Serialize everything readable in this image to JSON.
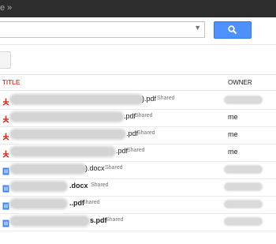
{
  "topbar": {
    "text": "e »"
  },
  "search": {
    "value": "",
    "arrow": "▼"
  },
  "columns": {
    "title": "TITLE",
    "owner": "OWNER"
  },
  "rows": [
    {
      "icon": "pdf-icon",
      "ext": ").pdf",
      "shared": "Shared",
      "owner": ""
    },
    {
      "icon": "pdf-icon",
      "ext": ".pdf",
      "shared": "Shared",
      "owner": "me"
    },
    {
      "icon": "pdf-icon",
      "ext": ".pdf",
      "shared": "Shared",
      "owner": "me"
    },
    {
      "icon": "pdf-icon",
      "ext": ".pdf",
      "shared": "Shared",
      "owner": "me"
    },
    {
      "icon": "doc-icon",
      "ext": ").docx",
      "shared": "Shared",
      "owner": ""
    },
    {
      "icon": "doc-icon",
      "ext": ".docx",
      "shared": "Shared",
      "owner": ""
    },
    {
      "icon": "doc-icon",
      "ext": "..pdf",
      "shared": "Shared",
      "owner": ""
    },
    {
      "icon": "doc-icon",
      "ext": "s.pdf",
      "shared": "Shared",
      "owner": ""
    }
  ],
  "colors": {
    "accent": "#4d90fe",
    "title_header": "#dd4b39",
    "pdf": "#d93025",
    "doc": "#4285f4"
  }
}
